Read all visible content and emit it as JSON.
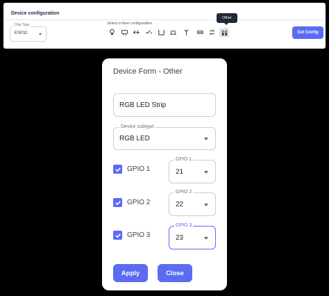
{
  "config": {
    "title": "Device configuration",
    "chip_type": {
      "label": "Chip Type",
      "value": "ESP32"
    },
    "select_label": "Select a New configuration",
    "device_icons": [
      "bulb-icon",
      "sensor-icon",
      "servo-icon",
      "relay-icon",
      "display-icon",
      "antenna-icon",
      "led-strip-icon",
      "swap-icon",
      "other-icon"
    ],
    "tooltip": "Other",
    "get_config_label": "Get Config"
  },
  "form": {
    "title": "Device Form - Other",
    "name_value": "RGB LED Strip",
    "subtype": {
      "label": "Device subtype",
      "value": "RGB LED"
    },
    "gpios": [
      {
        "label": "GPIO 1",
        "field_label": "GPIO 1",
        "value": "21",
        "checked": true
      },
      {
        "label": "GPIO 2",
        "field_label": "GPIO 2",
        "value": "22",
        "checked": true
      },
      {
        "label": "GPIO 3",
        "field_label": "GPIO 3",
        "value": "23",
        "checked": true
      }
    ],
    "apply_label": "Apply",
    "close_label": "Close"
  },
  "colors": {
    "accent": "#5b6cf2",
    "background": "#000000",
    "panel": "#ffffff"
  }
}
